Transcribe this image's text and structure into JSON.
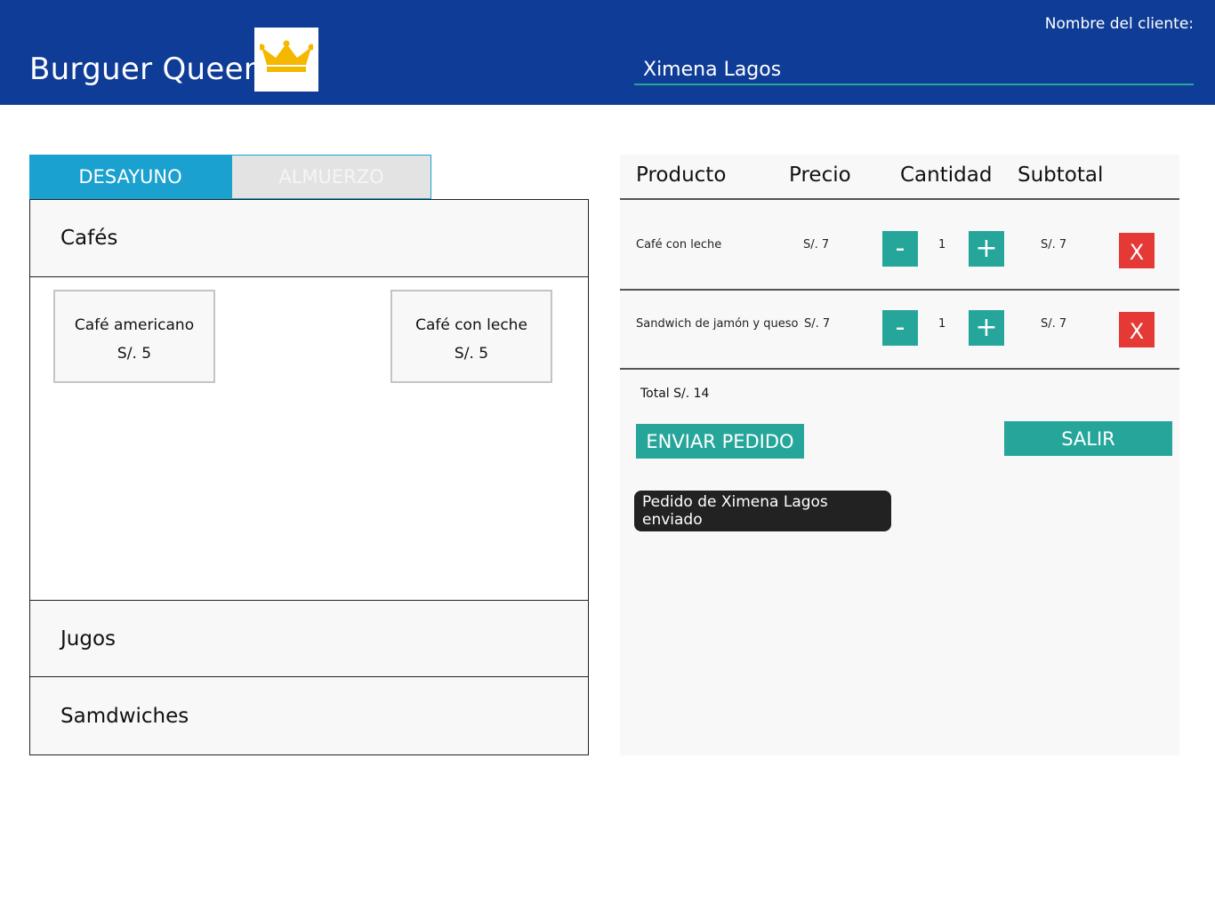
{
  "header": {
    "brand": "Burguer Queen",
    "logo_icon": "crown-icon",
    "client_label": "Nombre del cliente:",
    "client_name": "Ximena Lagos",
    "bg_color": "#0f3c96"
  },
  "menu": {
    "tabs": [
      {
        "label": "DESAYUNO",
        "active": true
      },
      {
        "label": "ALMUERZO",
        "active": false
      }
    ],
    "categories": [
      {
        "label": "Cafés",
        "expanded": true,
        "products": [
          {
            "name": "Café americano",
            "price": "S/. 5"
          },
          {
            "name": "Café con leche",
            "price": "S/. 5"
          }
        ]
      },
      {
        "label": "Jugos",
        "expanded": false
      },
      {
        "label": "Samdwiches",
        "expanded": false
      }
    ]
  },
  "order": {
    "columns": [
      "Producto",
      "Precio",
      "Cantidad",
      "Subtotal"
    ],
    "rows": [
      {
        "product": "Café con leche",
        "price": "S/. 7",
        "qty": "1",
        "subtotal": "S/. 7"
      },
      {
        "product": "Sandwich de jamón y queso",
        "price": "S/. 7",
        "qty": "1",
        "subtotal": "S/. 7"
      }
    ],
    "decrement_label": "-",
    "increment_label": "+",
    "remove_label": "X",
    "total": "Total S/. 14",
    "send_label": "ENVIAR PEDIDO",
    "exit_label": "SALIR",
    "toast": "Pedido de Ximena Lagos enviado"
  },
  "colors": {
    "accent": "#26a69a",
    "tab_active": "#1aa1cf",
    "danger": "#e53935",
    "crown": "#f5b800"
  }
}
